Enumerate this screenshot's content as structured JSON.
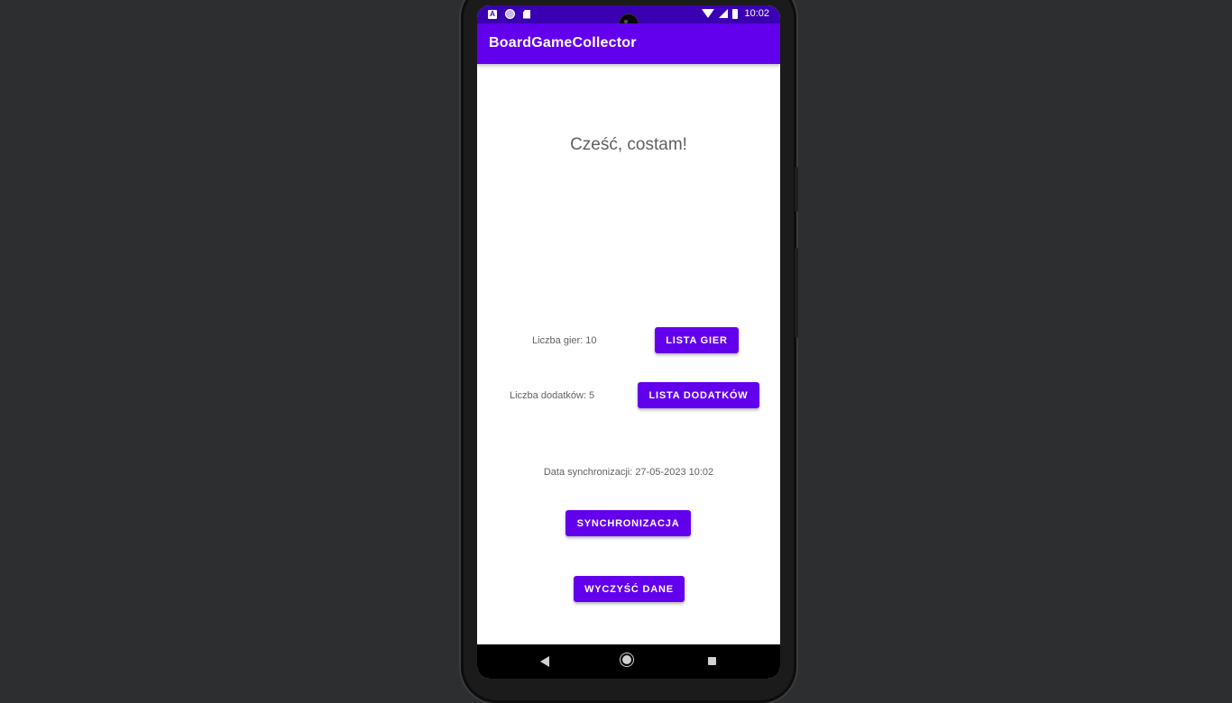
{
  "status_bar": {
    "time": "10:02",
    "left_icons": [
      "a-icon",
      "circle-icon",
      "sd-card-icon"
    ],
    "right_icons": [
      "wifi-icon",
      "signal-icon",
      "battery-icon"
    ]
  },
  "app_bar": {
    "title": "BoardGameCollector"
  },
  "main": {
    "greeting": "Cześć, costam!",
    "games_count_label": "Liczba gier: 10",
    "games_button": "LISTA GIER",
    "addons_count_label": "Liczba dodatków: 5",
    "addons_button": "LISTA DODATKÓW",
    "sync_date_label": "Data synchronizacji: 27-05-2023 10:02",
    "sync_button": "SYNCHRONIZACJA",
    "clear_button": "WYCZYŚĆ DANE"
  },
  "nav_bar": {
    "buttons": [
      "back-icon",
      "home-icon",
      "recents-icon"
    ]
  },
  "colors": {
    "primary": "#6200ee",
    "primary_dark": "#3a00b2",
    "background": "#2d2e30"
  }
}
